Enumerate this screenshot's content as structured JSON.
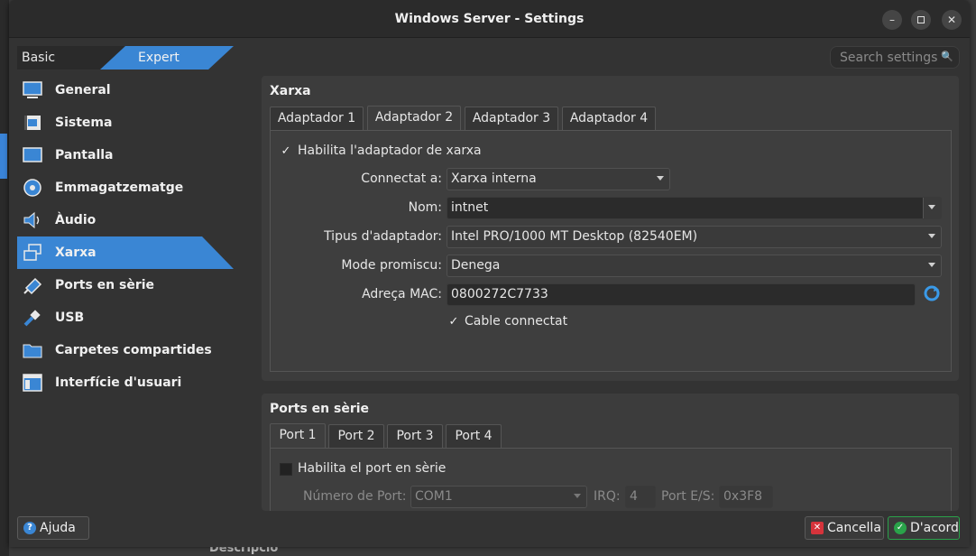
{
  "window": {
    "title": "Windows Server - Settings"
  },
  "modes": {
    "basic": "Basic",
    "expert": "Expert",
    "selected": "Expert"
  },
  "search": {
    "placeholder": "Search settings"
  },
  "sidebar": {
    "items": [
      {
        "label": "General",
        "icon": "monitor-icon"
      },
      {
        "label": "Sistema",
        "icon": "chip-icon"
      },
      {
        "label": "Pantalla",
        "icon": "display-icon"
      },
      {
        "label": "Emmagatzematge",
        "icon": "disk-icon"
      },
      {
        "label": "Àudio",
        "icon": "speaker-icon"
      },
      {
        "label": "Xarxa",
        "icon": "network-icon",
        "selected": true
      },
      {
        "label": "Ports en sèrie",
        "icon": "serial-port-icon"
      },
      {
        "label": "USB",
        "icon": "usb-icon"
      },
      {
        "label": "Carpetes compartides",
        "icon": "folder-icon"
      },
      {
        "label": "Interfície d'usuari",
        "icon": "ui-icon"
      }
    ]
  },
  "network": {
    "title": "Xarxa",
    "tabs": [
      "Adaptador 1",
      "Adaptador 2",
      "Adaptador 3",
      "Adaptador 4"
    ],
    "selected_tab": "Adaptador 2",
    "enable_label": "Habilita l'adaptador de xarxa",
    "enable_checked": true,
    "attached_label": "Connectat a:",
    "attached_value": "Xarxa interna",
    "name_label": "Nom:",
    "name_value": "intnet",
    "type_label": "Tipus d'adaptador:",
    "type_value": "Intel PRO/1000 MT Desktop (82540EM)",
    "promisc_label": "Mode promiscu:",
    "promisc_value": "Denega",
    "mac_label": "Adreça MAC:",
    "mac_value": "0800272C7733",
    "cable_label": "Cable connectat",
    "cable_checked": true
  },
  "serial": {
    "title": "Ports en sèrie",
    "tabs": [
      "Port 1",
      "Port 2",
      "Port 3",
      "Port 4"
    ],
    "selected_tab": "Port 1",
    "enable_label": "Habilita el port en sèrie",
    "enable_checked": false,
    "port_number_label": "Número de Port:",
    "port_number_value": "COM1",
    "irq_label": "IRQ:",
    "irq_value": "4",
    "io_label": "Port E/S:",
    "io_value": "0x3F8"
  },
  "footer": {
    "help": "Ajuda",
    "cancel": "Cancella",
    "ok": "D'acord"
  },
  "background": {
    "text": "Descripció"
  },
  "colors": {
    "accent": "#3a86d4",
    "ok_icon": "#2aa34a",
    "cancel_icon": "#d6333b"
  }
}
